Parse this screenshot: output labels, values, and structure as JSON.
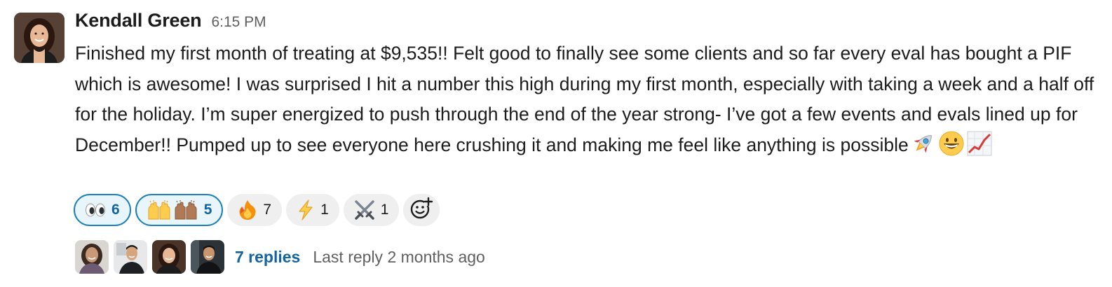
{
  "message": {
    "author": "Kendall Green",
    "timestamp": "6:15 PM",
    "text": "Finished my first month of treating at $9,535!! Felt good to finally see some clients and so far every eval has bought a PIF which is awesome! I was surprised I hit a number this high during my first month, especially with taking a week and a half off for the holiday. I’m super energized to push through the end of the year strong- I’ve got a few events and evals lined up for December!! Pumped up to see everyone here crushing it and making me feel like anything is possible",
    "inline_emojis": [
      "rocket",
      "grinning-face",
      "chart-increasing"
    ]
  },
  "reactions": [
    {
      "emoji": "eyes",
      "count": "6",
      "mine": true
    },
    {
      "emoji": "raised-hands",
      "count": "5",
      "mine": true
    },
    {
      "emoji": "fire",
      "count": "7",
      "mine": false
    },
    {
      "emoji": "high-voltage",
      "count": "1",
      "mine": false
    },
    {
      "emoji": "crossed-swords",
      "count": "1",
      "mine": false
    }
  ],
  "add_reaction_icon": "add-reaction-icon",
  "thread": {
    "replies_label": "7 replies",
    "last_reply": "Last reply 2 months ago",
    "participant_count": 4
  },
  "colors": {
    "link": "#1264a3",
    "reaction_mine_border": "#1d7fb8",
    "reaction_mine_bg": "#e8f5fa",
    "reaction_bg": "#efefef",
    "muted_text": "#616061"
  }
}
